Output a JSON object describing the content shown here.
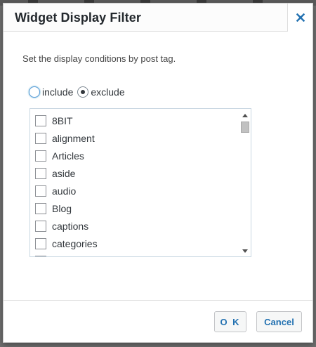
{
  "dialog": {
    "title": "Widget Display Filter",
    "close_icon": "close-x-icon",
    "description": "Set the display conditions by post tag."
  },
  "mode": {
    "options": [
      {
        "label": "include",
        "selected": false
      },
      {
        "label": "exclude",
        "selected": true
      }
    ]
  },
  "tags": {
    "items": [
      {
        "label": "8BIT",
        "checked": false
      },
      {
        "label": "alignment",
        "checked": false
      },
      {
        "label": "Articles",
        "checked": false
      },
      {
        "label": "aside",
        "checked": false
      },
      {
        "label": "audio",
        "checked": false
      },
      {
        "label": "Blog",
        "checked": false
      },
      {
        "label": "captions",
        "checked": false
      },
      {
        "label": "categories",
        "checked": false
      }
    ]
  },
  "footer": {
    "ok_label": "O K",
    "cancel_label": "Cancel"
  },
  "colors": {
    "accent": "#2271b1",
    "close_icon": "#2271b1",
    "focus_ring": "#5b9dd9"
  }
}
